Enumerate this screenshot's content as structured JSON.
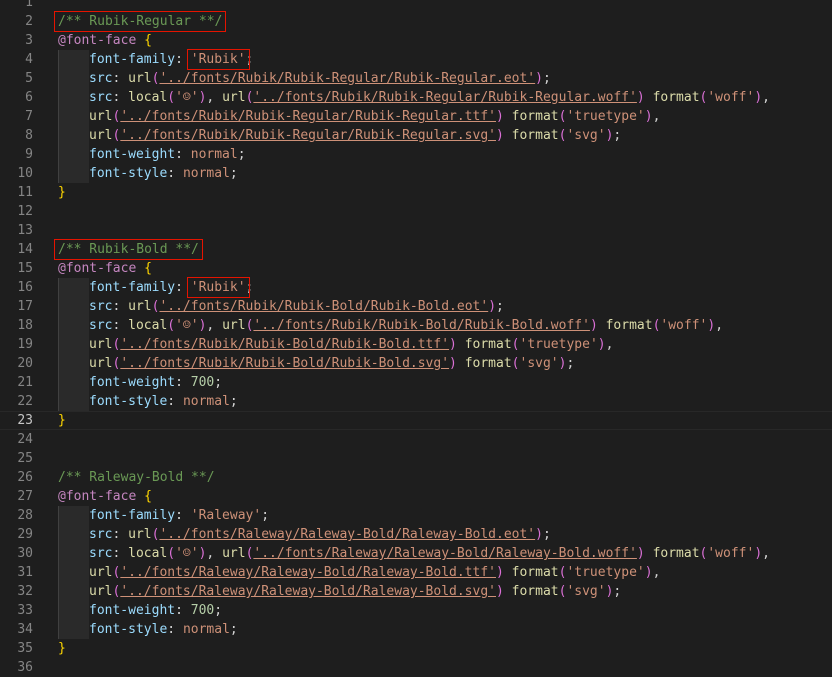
{
  "editor": {
    "language": "CSS",
    "current_line": 23,
    "lines": [
      {
        "n": "1",
        "indent": 0,
        "tokens": []
      },
      {
        "n": "2",
        "indent": 0,
        "tokens": [
          {
            "t": "comment",
            "v": "/** Rubik-Regular **/"
          }
        ]
      },
      {
        "n": "3",
        "indent": 0,
        "tokens": [
          {
            "t": "atrule",
            "v": "@font-face"
          },
          {
            "t": "plain",
            "v": " "
          },
          {
            "t": "brace",
            "v": "{"
          }
        ]
      },
      {
        "n": "4",
        "indent": 1,
        "tokens": [
          {
            "t": "prop",
            "v": "font-family"
          },
          {
            "t": "plain",
            "v": ": "
          },
          {
            "t": "str",
            "v": "'Rubik'"
          },
          {
            "t": "plain",
            "v": ";"
          }
        ]
      },
      {
        "n": "5",
        "indent": 1,
        "tokens": [
          {
            "t": "prop",
            "v": "src"
          },
          {
            "t": "plain",
            "v": ": "
          },
          {
            "t": "fn",
            "v": "url"
          },
          {
            "t": "paren",
            "v": "("
          },
          {
            "t": "url",
            "v": "'../fonts/Rubik/Rubik-Regular/Rubik-Regular.eot'"
          },
          {
            "t": "paren",
            "v": ")"
          },
          {
            "t": "plain",
            "v": ";"
          }
        ]
      },
      {
        "n": "6",
        "indent": 1,
        "tokens": [
          {
            "t": "prop",
            "v": "src"
          },
          {
            "t": "plain",
            "v": ": "
          },
          {
            "t": "fn",
            "v": "local"
          },
          {
            "t": "paren",
            "v": "("
          },
          {
            "t": "str",
            "v": "'☺'"
          },
          {
            "t": "paren",
            "v": ")"
          },
          {
            "t": "plain",
            "v": ", "
          },
          {
            "t": "fn",
            "v": "url"
          },
          {
            "t": "paren",
            "v": "("
          },
          {
            "t": "url",
            "v": "'../fonts/Rubik/Rubik-Regular/Rubik-Regular.woff'"
          },
          {
            "t": "paren",
            "v": ")"
          },
          {
            "t": "plain",
            "v": " "
          },
          {
            "t": "fn",
            "v": "format"
          },
          {
            "t": "paren",
            "v": "("
          },
          {
            "t": "str",
            "v": "'woff'"
          },
          {
            "t": "paren",
            "v": ")"
          },
          {
            "t": "plain",
            "v": ","
          }
        ]
      },
      {
        "n": "7",
        "indent": 1,
        "tokens": [
          {
            "t": "fn",
            "v": "url"
          },
          {
            "t": "paren",
            "v": "("
          },
          {
            "t": "url",
            "v": "'../fonts/Rubik/Rubik-Regular/Rubik-Regular.ttf'"
          },
          {
            "t": "paren",
            "v": ")"
          },
          {
            "t": "plain",
            "v": " "
          },
          {
            "t": "fn",
            "v": "format"
          },
          {
            "t": "paren",
            "v": "("
          },
          {
            "t": "str",
            "v": "'truetype'"
          },
          {
            "t": "paren",
            "v": ")"
          },
          {
            "t": "plain",
            "v": ","
          }
        ]
      },
      {
        "n": "8",
        "indent": 1,
        "tokens": [
          {
            "t": "fn",
            "v": "url"
          },
          {
            "t": "paren",
            "v": "("
          },
          {
            "t": "url",
            "v": "'../fonts/Rubik/Rubik-Regular/Rubik-Regular.svg'"
          },
          {
            "t": "paren",
            "v": ")"
          },
          {
            "t": "plain",
            "v": " "
          },
          {
            "t": "fn",
            "v": "format"
          },
          {
            "t": "paren",
            "v": "("
          },
          {
            "t": "str",
            "v": "'svg'"
          },
          {
            "t": "paren",
            "v": ")"
          },
          {
            "t": "plain",
            "v": ";"
          }
        ]
      },
      {
        "n": "9",
        "indent": 1,
        "tokens": [
          {
            "t": "prop",
            "v": "font-weight"
          },
          {
            "t": "plain",
            "v": ": "
          },
          {
            "t": "str",
            "v": "normal"
          },
          {
            "t": "plain",
            "v": ";"
          }
        ]
      },
      {
        "n": "10",
        "indent": 1,
        "tokens": [
          {
            "t": "prop",
            "v": "font-style"
          },
          {
            "t": "plain",
            "v": ": "
          },
          {
            "t": "str",
            "v": "normal"
          },
          {
            "t": "plain",
            "v": ";"
          }
        ]
      },
      {
        "n": "11",
        "indent": 0,
        "tokens": [
          {
            "t": "brace",
            "v": "}"
          }
        ]
      },
      {
        "n": "12",
        "indent": 0,
        "tokens": []
      },
      {
        "n": "13",
        "indent": 0,
        "tokens": []
      },
      {
        "n": "14",
        "indent": 0,
        "tokens": [
          {
            "t": "comment",
            "v": "/** Rubik-Bold **/"
          }
        ]
      },
      {
        "n": "15",
        "indent": 0,
        "tokens": [
          {
            "t": "atrule",
            "v": "@font-face"
          },
          {
            "t": "plain",
            "v": " "
          },
          {
            "t": "brace",
            "v": "{"
          }
        ]
      },
      {
        "n": "16",
        "indent": 1,
        "tokens": [
          {
            "t": "prop",
            "v": "font-family"
          },
          {
            "t": "plain",
            "v": ": "
          },
          {
            "t": "str",
            "v": "'Rubik'"
          },
          {
            "t": "plain",
            "v": ";"
          }
        ]
      },
      {
        "n": "17",
        "indent": 1,
        "tokens": [
          {
            "t": "prop",
            "v": "src"
          },
          {
            "t": "plain",
            "v": ": "
          },
          {
            "t": "fn",
            "v": "url"
          },
          {
            "t": "paren",
            "v": "("
          },
          {
            "t": "url",
            "v": "'../fonts/Rubik/Rubik-Bold/Rubik-Bold.eot'"
          },
          {
            "t": "paren",
            "v": ")"
          },
          {
            "t": "plain",
            "v": ";"
          }
        ]
      },
      {
        "n": "18",
        "indent": 1,
        "tokens": [
          {
            "t": "prop",
            "v": "src"
          },
          {
            "t": "plain",
            "v": ": "
          },
          {
            "t": "fn",
            "v": "local"
          },
          {
            "t": "paren",
            "v": "("
          },
          {
            "t": "str",
            "v": "'☺'"
          },
          {
            "t": "paren",
            "v": ")"
          },
          {
            "t": "plain",
            "v": ", "
          },
          {
            "t": "fn",
            "v": "url"
          },
          {
            "t": "paren",
            "v": "("
          },
          {
            "t": "url",
            "v": "'../fonts/Rubik/Rubik-Bold/Rubik-Bold.woff'"
          },
          {
            "t": "paren",
            "v": ")"
          },
          {
            "t": "plain",
            "v": " "
          },
          {
            "t": "fn",
            "v": "format"
          },
          {
            "t": "paren",
            "v": "("
          },
          {
            "t": "str",
            "v": "'woff'"
          },
          {
            "t": "paren",
            "v": ")"
          },
          {
            "t": "plain",
            "v": ","
          }
        ]
      },
      {
        "n": "19",
        "indent": 1,
        "tokens": [
          {
            "t": "fn",
            "v": "url"
          },
          {
            "t": "paren",
            "v": "("
          },
          {
            "t": "url",
            "v": "'../fonts/Rubik/Rubik-Bold/Rubik-Bold.ttf'"
          },
          {
            "t": "paren",
            "v": ")"
          },
          {
            "t": "plain",
            "v": " "
          },
          {
            "t": "fn",
            "v": "format"
          },
          {
            "t": "paren",
            "v": "("
          },
          {
            "t": "str",
            "v": "'truetype'"
          },
          {
            "t": "paren",
            "v": ")"
          },
          {
            "t": "plain",
            "v": ","
          }
        ]
      },
      {
        "n": "20",
        "indent": 1,
        "tokens": [
          {
            "t": "fn",
            "v": "url"
          },
          {
            "t": "paren",
            "v": "("
          },
          {
            "t": "url",
            "v": "'../fonts/Rubik/Rubik-Bold/Rubik-Bold.svg'"
          },
          {
            "t": "paren",
            "v": ")"
          },
          {
            "t": "plain",
            "v": " "
          },
          {
            "t": "fn",
            "v": "format"
          },
          {
            "t": "paren",
            "v": "("
          },
          {
            "t": "str",
            "v": "'svg'"
          },
          {
            "t": "paren",
            "v": ")"
          },
          {
            "t": "plain",
            "v": ";"
          }
        ]
      },
      {
        "n": "21",
        "indent": 1,
        "tokens": [
          {
            "t": "prop",
            "v": "font-weight"
          },
          {
            "t": "plain",
            "v": ": "
          },
          {
            "t": "num",
            "v": "700"
          },
          {
            "t": "plain",
            "v": ";"
          }
        ]
      },
      {
        "n": "22",
        "indent": 1,
        "tokens": [
          {
            "t": "prop",
            "v": "font-style"
          },
          {
            "t": "plain",
            "v": ": "
          },
          {
            "t": "str",
            "v": "normal"
          },
          {
            "t": "plain",
            "v": ";"
          }
        ]
      },
      {
        "n": "23",
        "indent": 0,
        "tokens": [
          {
            "t": "brace",
            "v": "}"
          }
        ]
      },
      {
        "n": "24",
        "indent": 0,
        "tokens": []
      },
      {
        "n": "25",
        "indent": 0,
        "tokens": []
      },
      {
        "n": "26",
        "indent": 0,
        "tokens": [
          {
            "t": "comment",
            "v": "/** Raleway-Bold **/"
          }
        ]
      },
      {
        "n": "27",
        "indent": 0,
        "tokens": [
          {
            "t": "atrule",
            "v": "@font-face"
          },
          {
            "t": "plain",
            "v": " "
          },
          {
            "t": "brace",
            "v": "{"
          }
        ]
      },
      {
        "n": "28",
        "indent": 1,
        "tokens": [
          {
            "t": "prop",
            "v": "font-family"
          },
          {
            "t": "plain",
            "v": ": "
          },
          {
            "t": "str",
            "v": "'Raleway'"
          },
          {
            "t": "plain",
            "v": ";"
          }
        ]
      },
      {
        "n": "29",
        "indent": 1,
        "tokens": [
          {
            "t": "prop",
            "v": "src"
          },
          {
            "t": "plain",
            "v": ": "
          },
          {
            "t": "fn",
            "v": "url"
          },
          {
            "t": "paren",
            "v": "("
          },
          {
            "t": "url",
            "v": "'../fonts/Raleway/Raleway-Bold/Raleway-Bold.eot'"
          },
          {
            "t": "paren",
            "v": ")"
          },
          {
            "t": "plain",
            "v": ";"
          }
        ]
      },
      {
        "n": "30",
        "indent": 1,
        "tokens": [
          {
            "t": "prop",
            "v": "src"
          },
          {
            "t": "plain",
            "v": ": "
          },
          {
            "t": "fn",
            "v": "local"
          },
          {
            "t": "paren",
            "v": "("
          },
          {
            "t": "str",
            "v": "'☺'"
          },
          {
            "t": "paren",
            "v": ")"
          },
          {
            "t": "plain",
            "v": ", "
          },
          {
            "t": "fn",
            "v": "url"
          },
          {
            "t": "paren",
            "v": "("
          },
          {
            "t": "url",
            "v": "'../fonts/Raleway/Raleway-Bold/Raleway-Bold.woff'"
          },
          {
            "t": "paren",
            "v": ")"
          },
          {
            "t": "plain",
            "v": " "
          },
          {
            "t": "fn",
            "v": "format"
          },
          {
            "t": "paren",
            "v": "("
          },
          {
            "t": "str",
            "v": "'woff'"
          },
          {
            "t": "paren",
            "v": ")"
          },
          {
            "t": "plain",
            "v": ","
          }
        ]
      },
      {
        "n": "31",
        "indent": 1,
        "tokens": [
          {
            "t": "fn",
            "v": "url"
          },
          {
            "t": "paren",
            "v": "("
          },
          {
            "t": "url",
            "v": "'../fonts/Raleway/Raleway-Bold/Raleway-Bold.ttf'"
          },
          {
            "t": "paren",
            "v": ")"
          },
          {
            "t": "plain",
            "v": " "
          },
          {
            "t": "fn",
            "v": "format"
          },
          {
            "t": "paren",
            "v": "("
          },
          {
            "t": "str",
            "v": "'truetype'"
          },
          {
            "t": "paren",
            "v": ")"
          },
          {
            "t": "plain",
            "v": ","
          }
        ]
      },
      {
        "n": "32",
        "indent": 1,
        "tokens": [
          {
            "t": "fn",
            "v": "url"
          },
          {
            "t": "paren",
            "v": "("
          },
          {
            "t": "url",
            "v": "'../fonts/Raleway/Raleway-Bold/Raleway-Bold.svg'"
          },
          {
            "t": "paren",
            "v": ")"
          },
          {
            "t": "plain",
            "v": " "
          },
          {
            "t": "fn",
            "v": "format"
          },
          {
            "t": "paren",
            "v": "("
          },
          {
            "t": "str",
            "v": "'svg'"
          },
          {
            "t": "paren",
            "v": ")"
          },
          {
            "t": "plain",
            "v": ";"
          }
        ]
      },
      {
        "n": "33",
        "indent": 1,
        "tokens": [
          {
            "t": "prop",
            "v": "font-weight"
          },
          {
            "t": "plain",
            "v": ": "
          },
          {
            "t": "num",
            "v": "700"
          },
          {
            "t": "plain",
            "v": ";"
          }
        ]
      },
      {
        "n": "34",
        "indent": 1,
        "tokens": [
          {
            "t": "prop",
            "v": "font-style"
          },
          {
            "t": "plain",
            "v": ": "
          },
          {
            "t": "str",
            "v": "normal"
          },
          {
            "t": "plain",
            "v": ";"
          }
        ]
      },
      {
        "n": "35",
        "indent": 0,
        "tokens": [
          {
            "t": "brace",
            "v": "}"
          }
        ]
      },
      {
        "n": "36",
        "indent": 0,
        "tokens": []
      }
    ]
  },
  "highlights": [
    {
      "line": 2,
      "target": "comment",
      "color": "#e51400"
    },
    {
      "line": 4,
      "target": "str",
      "color": "#e51400"
    },
    {
      "line": 14,
      "target": "comment",
      "color": "#e51400"
    },
    {
      "line": 16,
      "target": "str",
      "color": "#e51400"
    }
  ],
  "colors": {
    "background": "#1e1e1e",
    "comment": "#6a9955",
    "atrule": "#c586c0",
    "property": "#9cdcfe",
    "string": "#ce9178",
    "number": "#b5cea8",
    "function": "#dcdcaa",
    "brace": "#ffd700",
    "paren": "#da70d6",
    "annotation": "#e51400"
  }
}
